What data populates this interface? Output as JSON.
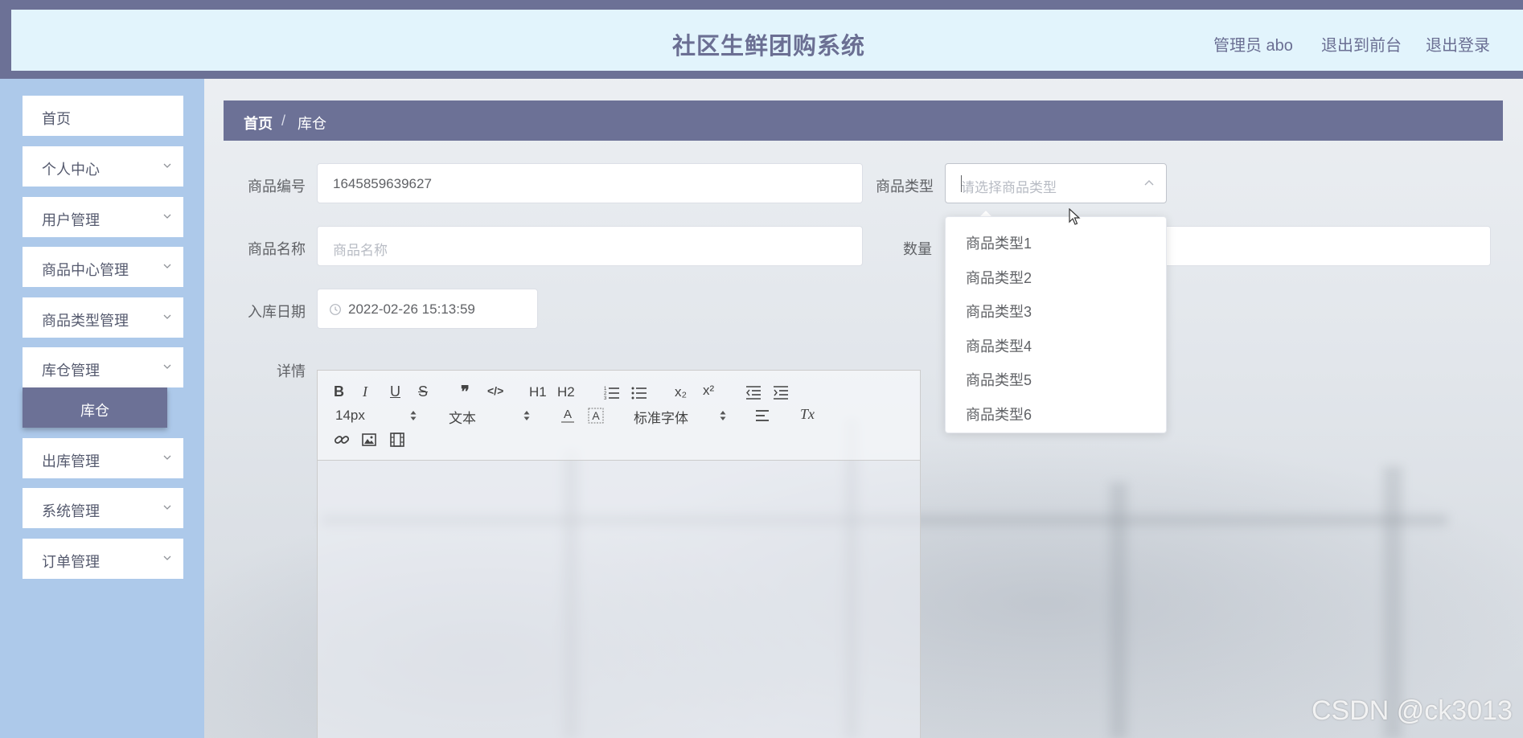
{
  "header": {
    "title": "社区生鲜团购系统",
    "admin_label": "管理员 abo",
    "exit_front_label": "退出到前台",
    "logout_label": "退出登录"
  },
  "sidebar": {
    "items": [
      {
        "label": "首页"
      },
      {
        "label": "个人中心"
      },
      {
        "label": "用户管理"
      },
      {
        "label": "商品中心管理"
      },
      {
        "label": "商品类型管理"
      },
      {
        "label": "库仓管理"
      },
      {
        "label": "出库管理"
      },
      {
        "label": "系统管理"
      },
      {
        "label": "订单管理"
      }
    ],
    "active_sub": "库仓"
  },
  "breadcrumb": {
    "home": "首页",
    "separator": "/",
    "current": "库仓"
  },
  "form": {
    "product_code": {
      "label": "商品编号",
      "value": "1645859639627"
    },
    "product_type": {
      "label": "商品类型",
      "placeholder": "请选择商品类型"
    },
    "product_name": {
      "label": "商品名称",
      "placeholder": "商品名称"
    },
    "quantity": {
      "label": "数量"
    },
    "stock_date": {
      "label": "入库日期",
      "value": "2022-02-26 15:13:59"
    },
    "details": {
      "label": "详情"
    }
  },
  "dropdown": {
    "options": [
      "商品类型1",
      "商品类型2",
      "商品类型3",
      "商品类型4",
      "商品类型5",
      "商品类型6"
    ]
  },
  "editor": {
    "font_size": "14px",
    "text_style": "文本",
    "font_family": "标准字体",
    "buttons": {
      "bold": "B",
      "italic": "I",
      "underline": "U",
      "strike": "S",
      "quote": "❞",
      "code": "</>",
      "h1": "H1",
      "h2": "H2",
      "sub": "x₂",
      "sup": "x²",
      "clean": "Tx"
    }
  },
  "watermark": "CSDN @ck3013",
  "colors": {
    "header_bg": "#6c7196",
    "header_inner": "#e2f4fc",
    "sidebar_bg": "#adc9ea",
    "accent": "#6c7196"
  }
}
